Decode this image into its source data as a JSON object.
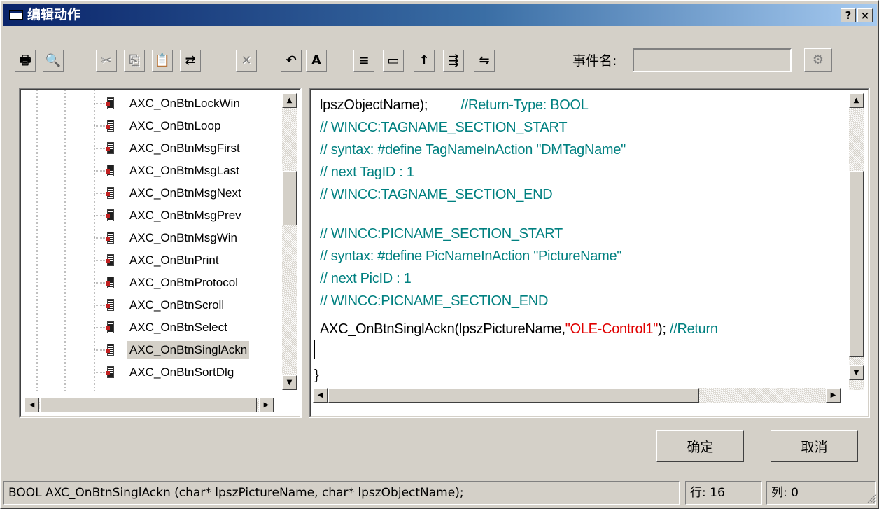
{
  "window": {
    "title": "编辑动作",
    "help_label": "?",
    "close_label": "×"
  },
  "toolbar": {
    "buttons": [
      {
        "name": "print-icon",
        "glyph": "🖶",
        "enabled": true
      },
      {
        "name": "print-preview-icon",
        "glyph": "🔍",
        "enabled": true
      },
      {
        "name": "cut-icon",
        "glyph": "✂",
        "enabled": false
      },
      {
        "name": "copy-icon",
        "glyph": "⎘",
        "enabled": false
      },
      {
        "name": "paste-icon",
        "glyph": "📋",
        "enabled": true
      },
      {
        "name": "paste-special-icon",
        "glyph": "⇄",
        "enabled": true
      },
      {
        "name": "delete-icon",
        "glyph": "✕",
        "enabled": false
      },
      {
        "name": "undo-icon",
        "glyph": "↶",
        "enabled": true
      },
      {
        "name": "replace-icon",
        "glyph": "A",
        "enabled": true
      },
      {
        "name": "compile-icon",
        "glyph": "≡",
        "enabled": true
      },
      {
        "name": "open-icon",
        "glyph": "▭",
        "enabled": true
      },
      {
        "name": "import-icon",
        "glyph": "↑",
        "enabled": true
      },
      {
        "name": "export-icon",
        "glyph": "⇶",
        "enabled": true
      },
      {
        "name": "settings-icon",
        "glyph": "⇋",
        "enabled": true
      }
    ],
    "event_label": "事件名:",
    "event_value": ""
  },
  "tree": {
    "items": [
      "AXC_OnBtnLockWin",
      "AXC_OnBtnLoop",
      "AXC_OnBtnMsgFirst",
      "AXC_OnBtnMsgLast",
      "AXC_OnBtnMsgNext",
      "AXC_OnBtnMsgPrev",
      "AXC_OnBtnMsgWin",
      "AXC_OnBtnPrint",
      "AXC_OnBtnProtocol",
      "AXC_OnBtnScroll",
      "AXC_OnBtnSelect",
      "AXC_OnBtnSinglAckn",
      "AXC_OnBtnSortDlg"
    ],
    "selected_index": 11
  },
  "editor": {
    "line1_a": "lpszObjectName);",
    "line1_b": "//Return-Type: BOOL",
    "line2": "// WINCC:TAGNAME_SECTION_START",
    "line3": "// syntax: #define TagNameInAction \"DMTagName\"",
    "line4": "// next TagID : 1",
    "line5": "// WINCC:TAGNAME_SECTION_END",
    "line7": "// WINCC:PICNAME_SECTION_START",
    "line8": "// syntax: #define PicNameInAction \"PictureName\"",
    "line9": "// next PicID : 1",
    "line10": "// WINCC:PICNAME_SECTION_END",
    "line11_a": "AXC_OnBtnSinglAckn(lpszPictureName,",
    "line11_b": "\"OLE-Control1\"",
    "line11_c": ");",
    "line11_d": "//Return",
    "line13": "}"
  },
  "buttons": {
    "ok": "确定",
    "cancel": "取消"
  },
  "status": {
    "text": "BOOL AXC_OnBtnSinglAckn (char* lpszPictureName, char* lpszObjectName);",
    "row": "行: 16",
    "col": "列: 0"
  }
}
